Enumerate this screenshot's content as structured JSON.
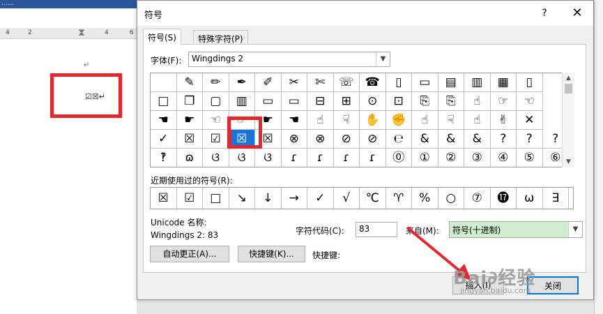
{
  "doc": {
    "titlebar_text": "……",
    "ruler_numbers": [
      "4",
      "2",
      "4",
      "6"
    ],
    "hourglass": "⧗",
    "para_marks": [
      "↵",
      "↵",
      "↵"
    ],
    "inserted_symbols": "☑☒↵"
  },
  "dialog": {
    "title": "符号",
    "help": "?",
    "close": "✕",
    "tabs": {
      "symbols": "符号(S)",
      "special": "特殊字符(P)"
    },
    "font_label": "字体(F):",
    "font_value": "Wingdings 2",
    "grid_rows": [
      [
        "",
        "✎",
        "✏",
        "✒",
        "✐",
        "✂",
        "✄",
        "☏",
        "☎",
        "▯",
        "▭",
        "▤",
        "▥",
        "▦",
        "▯"
      ],
      [
        "□",
        "❐",
        "▢",
        "▥",
        "▭",
        "▭",
        "⊟",
        "⊞",
        "⊙",
        "⊡",
        "⎘",
        "⎘",
        "☝",
        "☞",
        "☜"
      ],
      [
        "☚",
        "☛",
        "☜",
        "☞",
        "☛",
        "☚",
        "☝",
        "☟",
        "✋",
        "✊",
        "☝",
        "☟",
        "☝",
        "✌",
        "✕"
      ],
      [
        "✓",
        "☒",
        "☑",
        "☒",
        "☒",
        "⊗",
        "⊗",
        "⊘",
        "⊘",
        "℮",
        "&",
        "&",
        "&",
        "?",
        "?",
        "?"
      ],
      [
        "‽",
        "ɷ",
        "ଓ",
        "ଓ",
        "ଓ",
        "ɾ",
        "ɾ",
        "ɾ",
        "ɾ",
        "⓪",
        "①",
        "②",
        "③",
        "④",
        "⑤",
        "⑥"
      ]
    ],
    "recent_label": "近期使用过的符号(R):",
    "recent": [
      "☒",
      "☑",
      "□",
      "↘",
      "↓",
      "→",
      "✓",
      "√",
      "℃",
      "♈",
      "%",
      "○",
      "⑦",
      "⓱",
      "ω",
      "∃"
    ],
    "unicode_label": "Unicode 名称:",
    "unicode_value": "Wingdings 2: 83",
    "code_label": "字符代码(C):",
    "code_value": "83",
    "from_label": "来自(M):",
    "from_value": "符号(十进制)",
    "autocorrect_btn": "自动更正(A)...",
    "shortcut_btn": "快捷键(K)...",
    "shortcut_label": "快捷键:",
    "insert_btn": "插入(I)",
    "cancel_btn": "关闭"
  },
  "watermark": {
    "big": "Bai&#x0;经验",
    "small": "jingyan.baidu.com"
  },
  "colors": {
    "highlight": "#1a75d9",
    "annotation": "#e8262d",
    "from_bg": "#cfeecf"
  }
}
